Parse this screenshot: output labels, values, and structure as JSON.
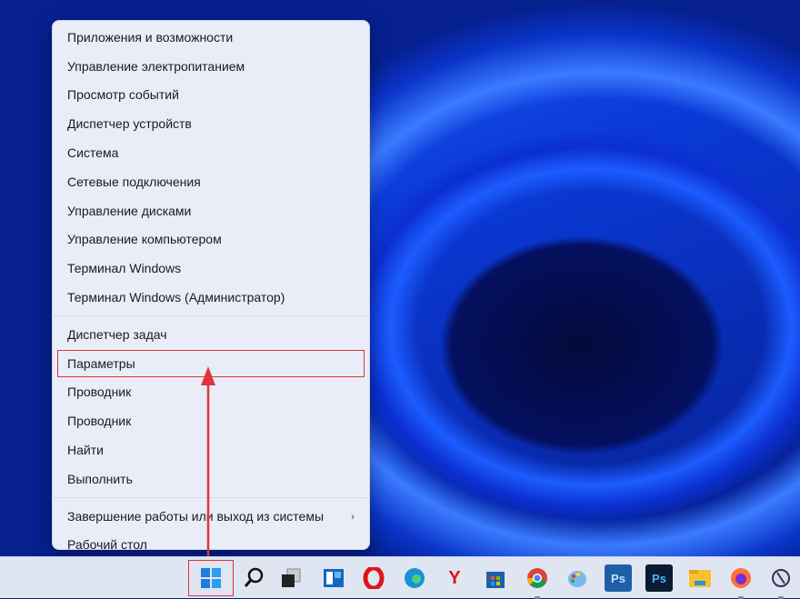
{
  "menu": {
    "group1": [
      "Приложения и возможности",
      "Управление электропитанием",
      "Просмотр событий",
      "Диспетчер устройств",
      "Система",
      "Сетевые подключения",
      "Управление дисками",
      "Управление компьютером",
      "Терминал Windows",
      "Терминал Windows (Администратор)"
    ],
    "group2": [
      "Диспетчер задач",
      "Параметры",
      "Проводник",
      "Проводник",
      "Найти",
      "Выполнить"
    ],
    "group3": [
      "Завершение работы или выход из системы",
      "Рабочий стол"
    ],
    "highlighted": "Параметры"
  },
  "taskbar": {
    "icons": [
      "start-icon",
      "search-icon",
      "task-view-icon",
      "widgets-icon",
      "opera-icon",
      "edge-icon",
      "yandex-icon",
      "store-icon",
      "chrome-icon",
      "paint-icon",
      "photoshop-icon",
      "photoshop-icon",
      "file-explorer-icon",
      "firefox-icon",
      "app-icon"
    ],
    "ps_label": "Ps",
    "yandex_label": "Y"
  },
  "colors": {
    "highlight": "#e0343a",
    "arrow": "#e0343a"
  }
}
